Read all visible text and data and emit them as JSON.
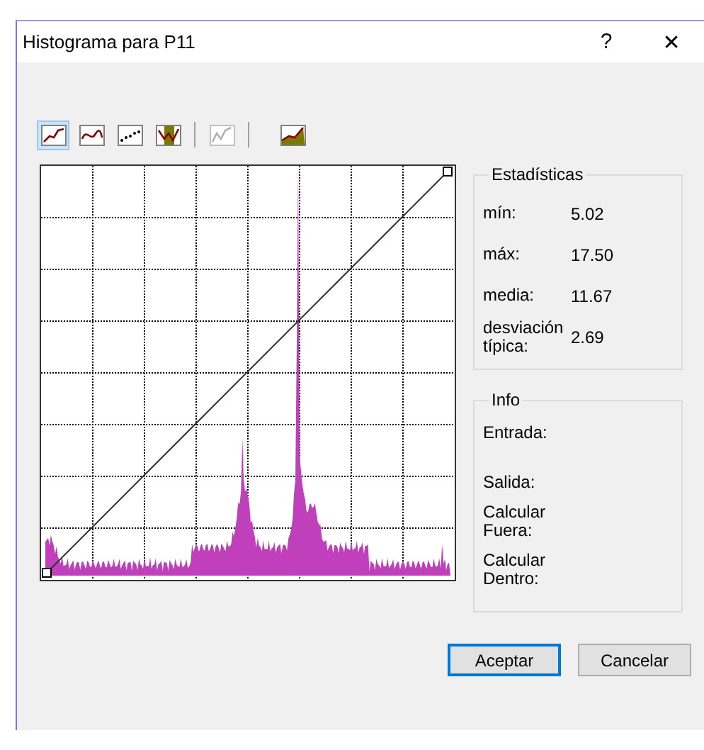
{
  "window": {
    "title": "Histograma para P11",
    "help": "?",
    "close": "✕"
  },
  "toolbar": [
    {
      "kind": "line",
      "selected": true,
      "disabled": false
    },
    {
      "kind": "curve",
      "selected": false,
      "disabled": false
    },
    {
      "kind": "dots",
      "selected": false,
      "disabled": false
    },
    {
      "kind": "band",
      "selected": false,
      "disabled": false
    },
    {
      "kind": "faded",
      "selected": false,
      "disabled": true
    },
    {
      "kind": "area",
      "selected": false,
      "disabled": false
    }
  ],
  "statistics": {
    "title": "Estadísticas",
    "rows": [
      {
        "label": "mín:",
        "value": "5.02"
      },
      {
        "label": "máx:",
        "value": "17.50"
      },
      {
        "label": "media:",
        "value": "11.67"
      },
      {
        "label": "desviación típica:",
        "value": "2.69"
      }
    ]
  },
  "info": {
    "title": "Info",
    "rows": [
      "Entrada:",
      "Salida:",
      "Calcular Fuera:",
      "Calcular Dentro:"
    ]
  },
  "buttons": [
    {
      "label": "Aceptar",
      "default": true
    },
    {
      "label": "Cancelar",
      "default": false
    }
  ]
}
